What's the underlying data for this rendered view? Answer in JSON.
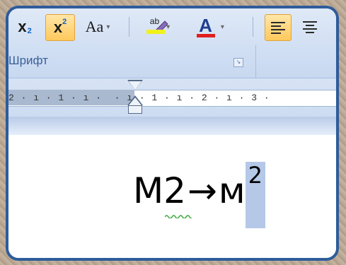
{
  "ribbon": {
    "subscript_label": "x",
    "subscript_mini": "2",
    "superscript_label": "x",
    "superscript_mini": "2",
    "change_case_label": "Aa",
    "highlight_label": "ab",
    "font_color_label": "A",
    "group_label": "Шрифт",
    "colors": {
      "highlight": "#f1f11a",
      "font_color": "#e01f1f",
      "active": "#ffc95c"
    }
  },
  "ruler": {
    "scale_text": "2 · ı · 1 · ı ·  · ı · 1 · ı · 2 · ı · 3 ·"
  },
  "document": {
    "formula_left": "M2",
    "arrow": "→",
    "formula_right": "м",
    "superscript": "2"
  }
}
